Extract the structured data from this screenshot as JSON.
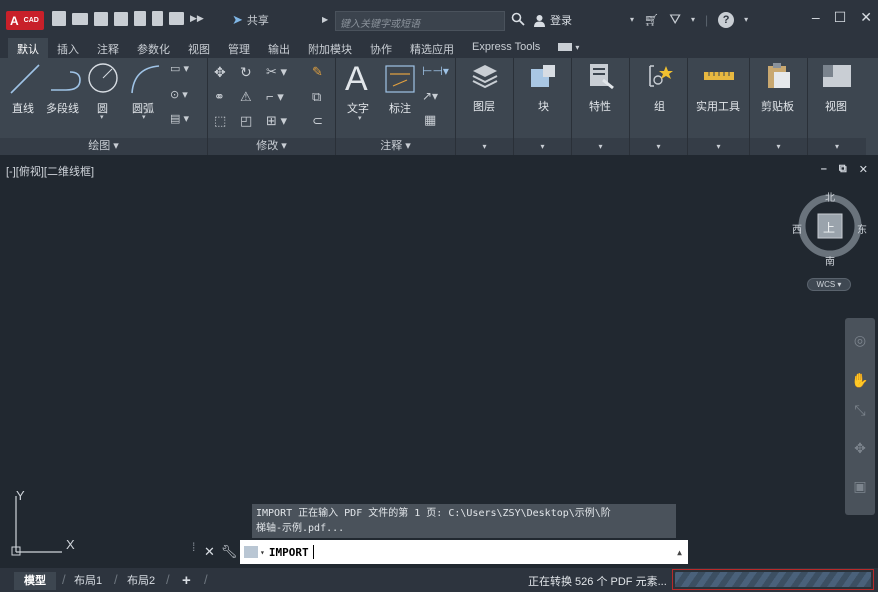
{
  "titlebar": {
    "logo_text": "A",
    "logo_sub": "CAD",
    "share_label": "共享",
    "search_placeholder": "键入关键字或短语",
    "login_label": "登录"
  },
  "tabs": [
    "默认",
    "插入",
    "注释",
    "参数化",
    "视图",
    "管理",
    "输出",
    "附加模块",
    "协作",
    "精选应用",
    "Express Tools"
  ],
  "ribbon": {
    "draw": {
      "tools": [
        "直线",
        "多段线",
        "圆",
        "圆弧"
      ],
      "footer": "绘图 ▾"
    },
    "modify": {
      "footer": "修改 ▾"
    },
    "annotate": {
      "tools": [
        "文字",
        "标注"
      ],
      "footer": "注释 ▾"
    },
    "big_buttons": [
      "图层",
      "块",
      "特性",
      "组",
      "实用工具",
      "剪贴板",
      "视图"
    ]
  },
  "viewport": {
    "label": "[-][俯视][二维线框]",
    "viewcube_face": "上",
    "compass": {
      "north": "北",
      "south": "南",
      "east": "东",
      "west": "西"
    },
    "wcs": "WCS ▾",
    "ucs_x": "X",
    "ucs_y": "Y"
  },
  "command": {
    "history_line1": "IMPORT 正在输入 PDF 文件的第 1 页: C:\\Users\\ZSY\\Desktop\\示例\\阶",
    "history_line2": "梯轴-示例.pdf...",
    "input": "IMPORT"
  },
  "statusbar": {
    "layout_tabs": [
      "模型",
      "布局1",
      "布局2"
    ],
    "add_tab": "+",
    "status_text": "正在转换 526 个 PDF 元素...",
    "progress_percent": 100
  },
  "colors": {
    "background": "#212830",
    "ribbon": "#3d4650",
    "logo_red": "#c8202a",
    "progress_border": "#b82a2a"
  }
}
